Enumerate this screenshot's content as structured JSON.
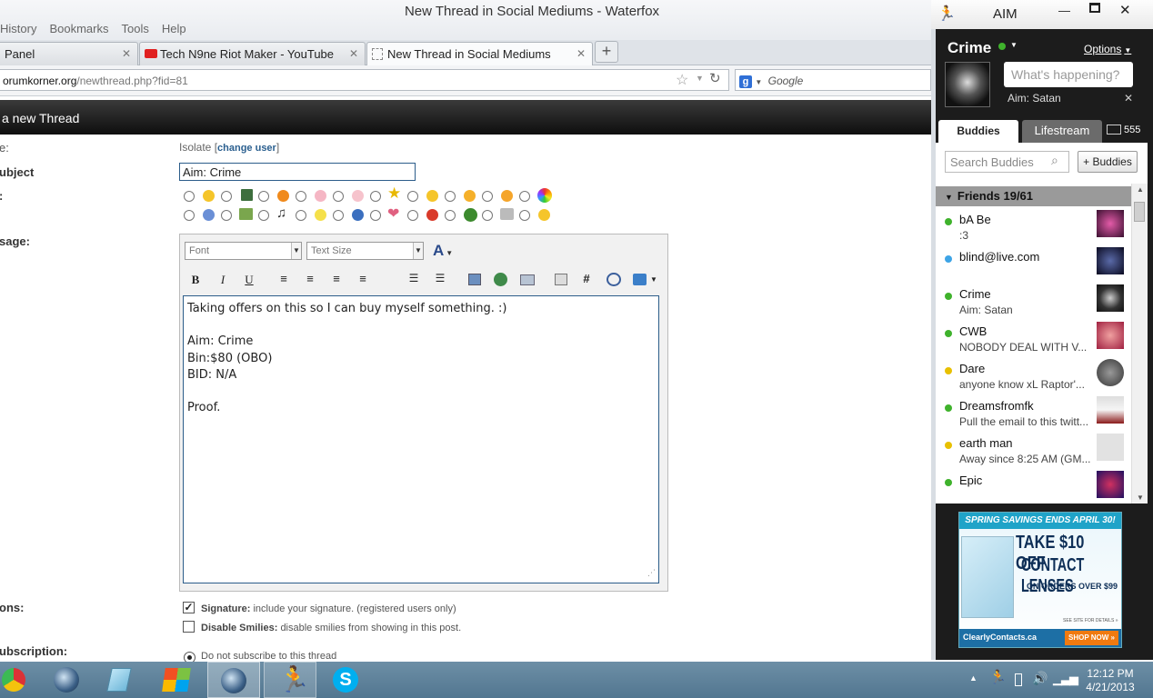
{
  "window": {
    "title": "New Thread in Social Mediums - Waterfox"
  },
  "menu": [
    "History",
    "Bookmarks",
    "Tools",
    "Help"
  ],
  "tabs": [
    {
      "label": "Panel"
    },
    {
      "label": "Tech N9ne Riot Maker - YouTube"
    },
    {
      "label": "New Thread in Social Mediums"
    }
  ],
  "nav": {
    "url_domain": "orumkorner.org",
    "url_path": "/newthread.php?fid=81",
    "search_placeholder": "Google"
  },
  "page": {
    "header": "a new Thread",
    "labels": {
      "username": "e:",
      "subject": "ubject",
      "icon": ":",
      "message": "sage:",
      "options": "ons:",
      "subscription": "ubscription:"
    },
    "username": "Isolate",
    "change_user": "change user",
    "subject_value": "Aim: Crime",
    "editor": {
      "font_placeholder": "Font",
      "size_placeholder": "Text Size",
      "body": [
        "Taking offers on this so I can buy myself something. :)",
        "",
        "Aim: Crime",
        "Bin:$80 (OBO)",
        "BID: N/A",
        "",
        "Proof."
      ]
    },
    "options": {
      "signature_label": "Signature:",
      "signature_desc": "include your signature. (registered users only)",
      "signature_checked": true,
      "smilies_label": "Disable Smilies:",
      "smilies_desc": "disable smilies from showing in this post.",
      "smilies_checked": false
    },
    "subscription_option": "Do not subscribe to this thread"
  },
  "aim": {
    "app_title": "AIM",
    "user": "Crime",
    "status_placeholder": "What's happening?",
    "status_line": "Aim: Satan",
    "options_label": "Options",
    "tabs": {
      "buddies": "Buddies",
      "lifestream": "Lifestream",
      "mail_count": "555"
    },
    "search_placeholder": "Search Buddies",
    "add_buddies": "+ Buddies",
    "group": "Friends 19/61",
    "buddies": [
      {
        "name": "bA Be",
        "status": ":3",
        "presence": "#3fb22c"
      },
      {
        "name": "blind@live.com",
        "status": "",
        "presence": "#3da4e6"
      },
      {
        "name": "Crime",
        "status": "Aim: Satan",
        "presence": "#3fb22c"
      },
      {
        "name": "CWB",
        "status": "NOBODY DEAL WITH V...",
        "presence": "#3fb22c"
      },
      {
        "name": "Dare",
        "status": "anyone know xL Raptor'...",
        "presence": "#e8c000"
      },
      {
        "name": "Dreamsfromfk",
        "status": "Pull the email to this twitt...",
        "presence": "#3fb22c"
      },
      {
        "name": "earth man",
        "status": "Away since 8:25 AM (GM...",
        "presence": "#e8c000"
      },
      {
        "name": "Epic",
        "status": "",
        "presence": "#3fb22c"
      }
    ],
    "ad": {
      "line1": "SPRING SAVINGS ENDS APRIL 30!",
      "line2": "TAKE $10 OFF",
      "line3": "CONTACT LENSES",
      "line4": "ON ORDERS OVER $99",
      "line5": "SEE SITE FOR DETAILS »",
      "brand": "ClearlyContacts.ca",
      "cta": "SHOP NOW »"
    }
  },
  "taskbar": {
    "time": "12:12 PM",
    "date": "4/21/2013"
  }
}
